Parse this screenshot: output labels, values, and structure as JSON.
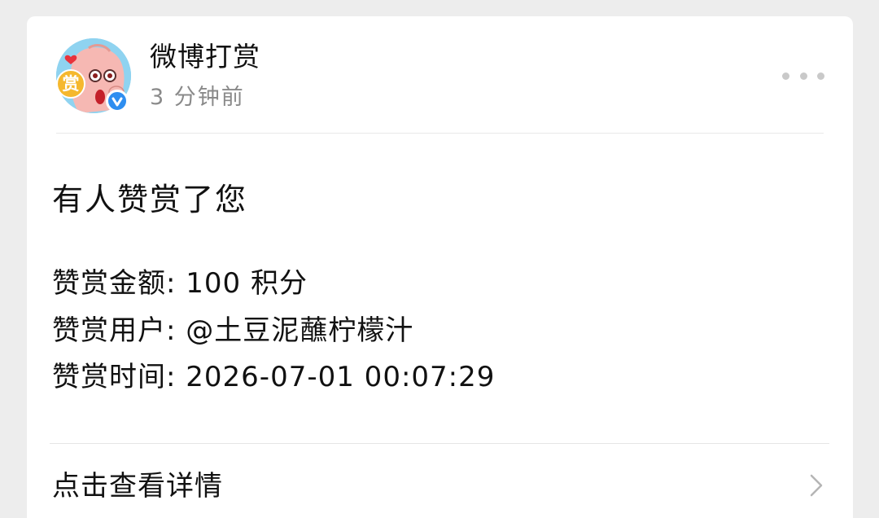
{
  "sender": {
    "name": "微博打赏",
    "time": "3 分钟前",
    "avatar_badge": "赏",
    "verified_icon": "verified-v-icon"
  },
  "more_icon": "more-dots-icon",
  "message": {
    "title": "有人赞赏了您",
    "amount_label": "赞赏金额:",
    "amount_value": "100 积分",
    "user_label": "赞赏用户:",
    "user_value": "@土豆泥蘸柠檬汁",
    "time_label": "赞赏时间:",
    "time_value": "2026-07-01 00:07:29"
  },
  "action": {
    "view_detail_label": "点击查看详情",
    "chevron_icon": "chevron-right-icon"
  },
  "colors": {
    "background": "#ededed",
    "card": "#ffffff",
    "secondary_text": "#8a8a8a",
    "verified_badge": "#2e8ef0",
    "badge_yellow": "#f5b82e"
  }
}
